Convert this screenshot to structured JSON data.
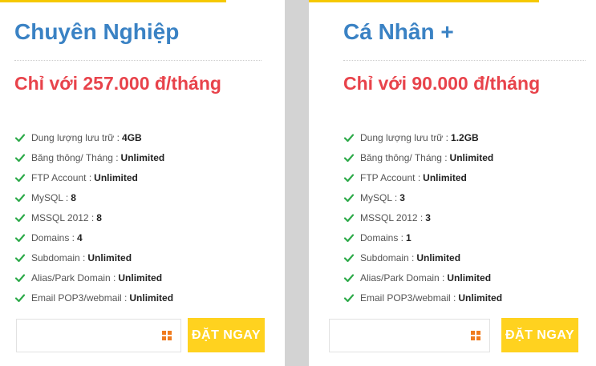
{
  "plans": [
    {
      "title": "Chuyên Nghiệp",
      "price": "Chỉ với 257.000 đ/tháng",
      "features": [
        {
          "label": "Dung lượng lưu trữ :",
          "value": "4GB"
        },
        {
          "label": "Băng thông/ Tháng :",
          "value": "Unlimited"
        },
        {
          "label": "FTP Account :",
          "value": "Unlimited"
        },
        {
          "label": "MySQL :",
          "value": "8"
        },
        {
          "label": "MSSQL 2012 :",
          "value": "8"
        },
        {
          "label": "Domains :",
          "value": "4"
        },
        {
          "label": "Subdomain :",
          "value": "Unlimited"
        },
        {
          "label": "Alias/Park Domain :",
          "value": "Unlimited"
        },
        {
          "label": "Email POP3/webmail :",
          "value": "Unlimited"
        }
      ],
      "stepper_value": "",
      "order_label": "ĐẶT NGAY"
    },
    {
      "title": "Cá Nhân +",
      "price": "Chỉ với 90.000 đ/tháng",
      "features": [
        {
          "label": "Dung lượng lưu trữ :",
          "value": "1.2GB"
        },
        {
          "label": "Băng thông/ Tháng :",
          "value": "Unlimited"
        },
        {
          "label": "FTP Account :",
          "value": "Unlimited"
        },
        {
          "label": "MySQL :",
          "value": "3"
        },
        {
          "label": "MSSQL 2012 :",
          "value": "3"
        },
        {
          "label": "Domains :",
          "value": "1"
        },
        {
          "label": "Subdomain :",
          "value": "Unlimited"
        },
        {
          "label": "Alias/Park Domain :",
          "value": "Unlimited"
        },
        {
          "label": "Email POP3/webmail :",
          "value": "Unlimited"
        }
      ],
      "stepper_value": "",
      "order_label": "ĐẶT NGAY"
    }
  ],
  "colors": {
    "title": "#3a82c4",
    "price": "#e8434b",
    "check": "#2eaa4a",
    "accent": "#ffd21f",
    "grid_icon": "#f07b1e"
  },
  "icons": {
    "check": "check-icon",
    "stepper": "grid-icon"
  }
}
